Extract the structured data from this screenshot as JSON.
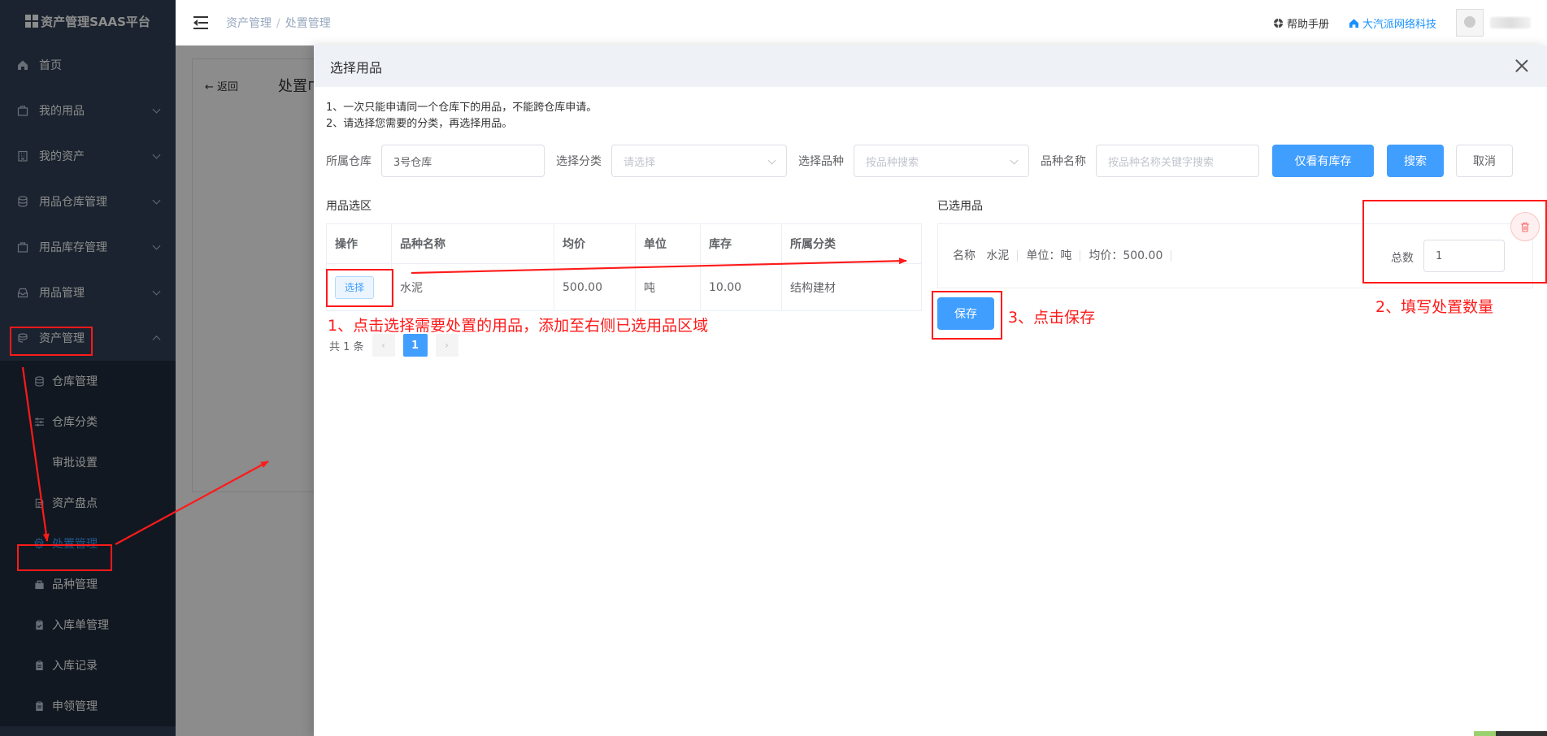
{
  "app": {
    "title": "资产管理SAAS平台"
  },
  "sidebar": {
    "items": [
      {
        "label": "首页",
        "icon": "home-icon"
      },
      {
        "label": "我的用品",
        "icon": "bag-icon"
      },
      {
        "label": "我的资产",
        "icon": "building-icon"
      },
      {
        "label": "用品仓库管理",
        "icon": "database-icon"
      },
      {
        "label": "用品库存管理",
        "icon": "bag-icon"
      },
      {
        "label": "用品管理",
        "icon": "inbox-icon"
      },
      {
        "label": "资产管理",
        "icon": "coins-icon"
      }
    ],
    "subitems": [
      {
        "label": "仓库管理",
        "icon": "database-icon"
      },
      {
        "label": "仓库分类",
        "icon": "sliders-icon"
      },
      {
        "label": "审批设置",
        "icon": "gear-icon"
      },
      {
        "label": "资产盘点",
        "icon": "document-icon"
      },
      {
        "label": "处置管理",
        "icon": "gear-icon"
      },
      {
        "label": "品种管理",
        "icon": "bag-icon"
      },
      {
        "label": "入库单管理",
        "icon": "clipboard-icon"
      },
      {
        "label": "入库记录",
        "icon": "clipboard-icon"
      },
      {
        "label": "申领管理",
        "icon": "clipboard-icon"
      }
    ]
  },
  "navbar": {
    "breadcrumb": [
      "资产管理",
      "处置管理"
    ],
    "breadcrumb_sep": "/",
    "help_label": "帮助手册",
    "company_label": "大汽派网络科技"
  },
  "background_page": {
    "back_label": "返回",
    "title": "处置巾"
  },
  "drawer": {
    "title": "选择用品",
    "tips": [
      "1、一次只能申请同一个仓库下的用品，不能跨仓库申请。",
      "2、请选择您需要的分类，再选择用品。"
    ],
    "filters": {
      "warehouse_label": "所属仓库",
      "warehouse_value": "3号仓库",
      "category_label": "选择分类",
      "category_placeholder": "请选择",
      "variety_label": "选择品种",
      "variety_placeholder": "按品种搜索",
      "name_label": "品种名称",
      "name_placeholder": "按品种名称关键字搜索",
      "in_stock_button": "仅看有库存",
      "search_button": "搜索",
      "cancel_button": "取消"
    },
    "pick_section_title": "用品选区",
    "table": {
      "columns": [
        "操作",
        "品种名称",
        "均价",
        "单位",
        "库存",
        "所属分类"
      ],
      "rows": [
        {
          "action": "选择",
          "name": "水泥",
          "price": "500.00",
          "unit": "吨",
          "stock": "10.00",
          "category": "结构建材"
        }
      ]
    },
    "pager": {
      "total": "共 1 条",
      "current": "1"
    },
    "selected_section_title": "已选用品",
    "selected": {
      "name_label": "名称",
      "name_value": "水泥",
      "unit_text": "单位：吨",
      "price_text": "均价：500.00",
      "qty_label": "总数",
      "qty_value": "1"
    },
    "save_button": "保存"
  },
  "annotations": {
    "step1": "1、点击选择需要处置的用品，添加至右侧已选用品区域",
    "step2": "2、填写处置数量",
    "step3": "3、点击保存",
    "color": "#ff1a1a"
  }
}
